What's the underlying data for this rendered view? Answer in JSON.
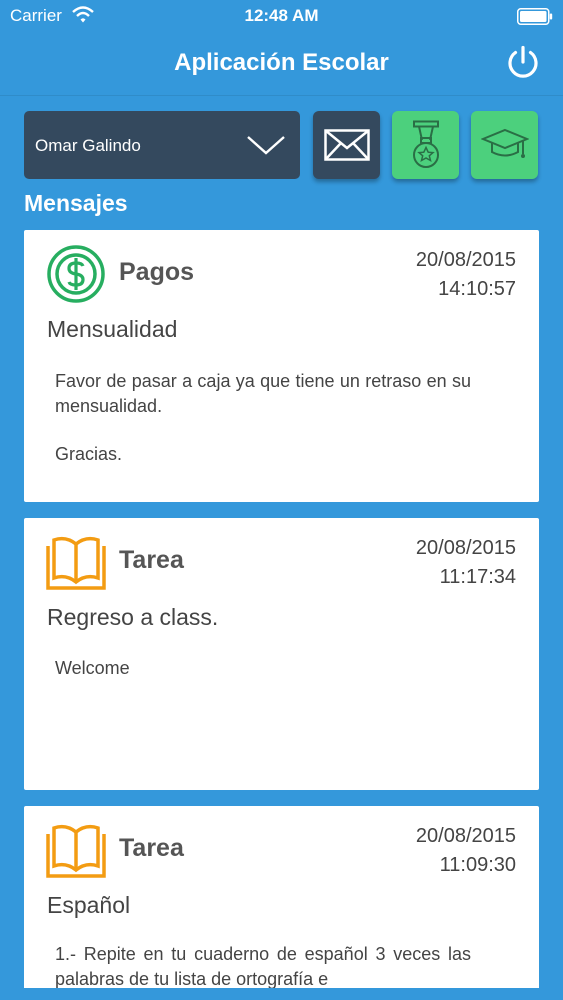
{
  "status_bar": {
    "carrier": "Carrier",
    "time": "12:48 AM"
  },
  "nav": {
    "title": "Aplicación Escolar",
    "power_icon": "power-icon"
  },
  "selector": {
    "student_name": "Omar Galindo"
  },
  "toolbar": {
    "mail_icon": "envelope-icon",
    "award_icon": "medal-icon",
    "grad_icon": "graduation-cap-icon"
  },
  "section": {
    "title": "Mensajes"
  },
  "colors": {
    "background": "#3498db",
    "dark": "#34495e",
    "green": "#4cd07d",
    "pagos": "#27ae60",
    "tarea": "#f39c12"
  },
  "messages": [
    {
      "category": "Pagos",
      "icon": "dollar-coin-icon",
      "date": "20/08/2015",
      "time": "14:10:57",
      "subject": "Mensualidad",
      "body": [
        "Favor de pasar a caja ya que tiene un retraso en su mensualidad.",
        "Gracias."
      ]
    },
    {
      "category": "Tarea",
      "icon": "book-icon",
      "date": "20/08/2015",
      "time": "11:17:34",
      "subject": "Regreso a class.",
      "body": [
        "Welcome"
      ]
    },
    {
      "category": "Tarea",
      "icon": "book-icon",
      "date": "20/08/2015",
      "time": "11:09:30",
      "subject": "Español",
      "body": [
        "1.- Repite en tu cuaderno de español 3 veces las palabras de tu lista de ortografía e"
      ]
    }
  ]
}
